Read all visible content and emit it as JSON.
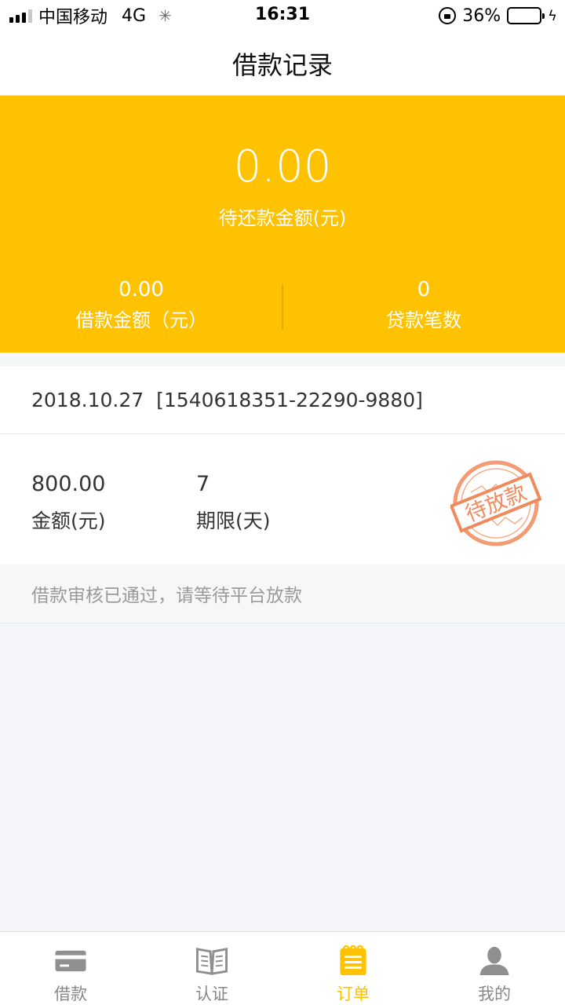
{
  "status_bar": {
    "carrier": "中国移动",
    "network": "4G",
    "time": "16:31",
    "battery_percent": "36%",
    "battery_level": 0.36
  },
  "nav": {
    "title": "借款记录"
  },
  "summary": {
    "pending_amount": "0.00",
    "pending_label": "待还款金额(元)",
    "loan_amount": "0.00",
    "loan_amount_label": "借款金额（元）",
    "loan_count": "0",
    "loan_count_label": "贷款笔数"
  },
  "record": {
    "date": "2018.10.27",
    "order_no": "[1540618351-22290-9880]",
    "amount": "800.00",
    "amount_label": "金额(元)",
    "term": "7",
    "term_label": "期限(天)",
    "stamp_text": "待放款",
    "note": "借款审核已通过，请等待平台放款"
  },
  "tabs": [
    {
      "label": "借款",
      "icon": "card-icon",
      "active": false
    },
    {
      "label": "认证",
      "icon": "book-icon",
      "active": false
    },
    {
      "label": "订单",
      "icon": "notepad-icon",
      "active": true
    },
    {
      "label": "我的",
      "icon": "person-icon",
      "active": false
    }
  ],
  "colors": {
    "accent": "#fec200",
    "stamp": "#f08a5d",
    "inactive": "#888888"
  }
}
